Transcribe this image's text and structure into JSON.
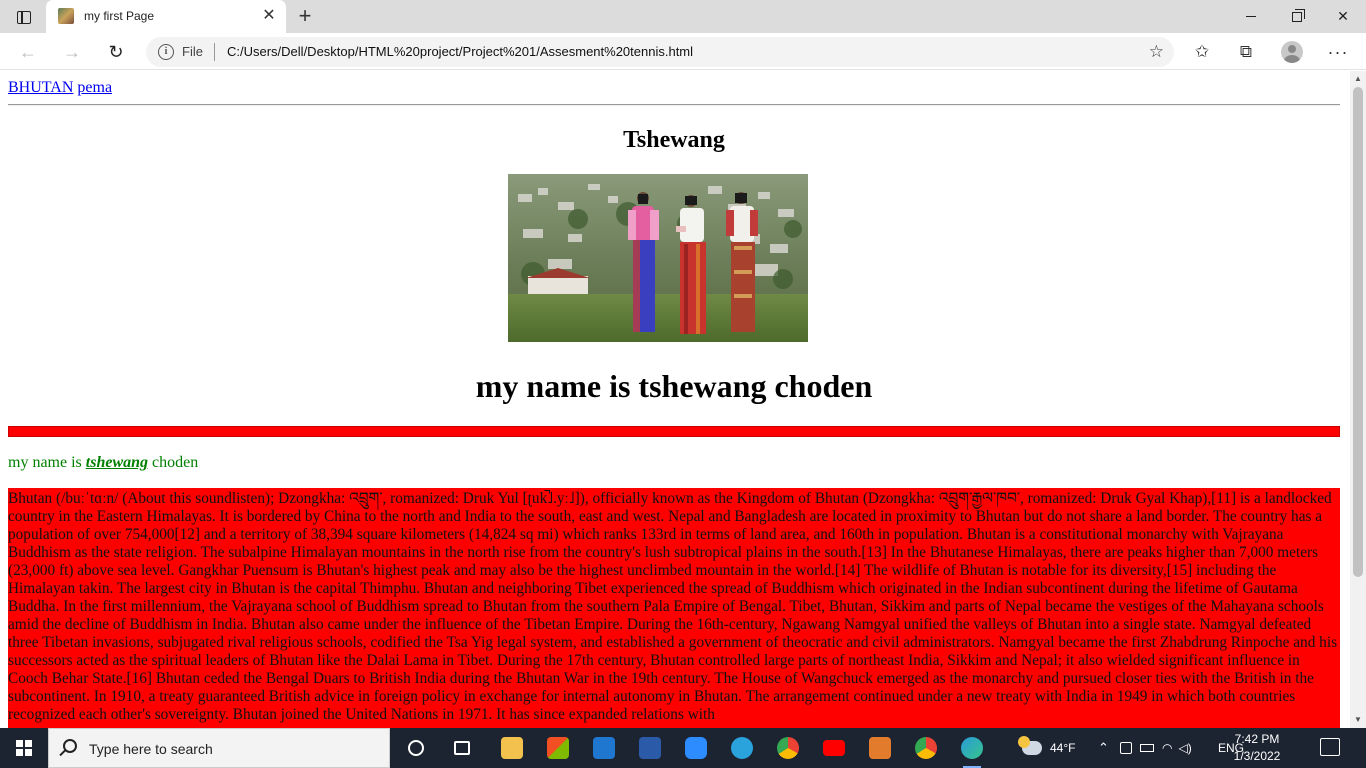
{
  "browser": {
    "tab_title": "my first Page",
    "tab_close": "✕",
    "new_tab": "+",
    "file_label": "File",
    "url": "C:/Users/Dell/Desktop/HTML%20project/Project%201/Assesment%20tennis.html",
    "nav_back": "←",
    "nav_forward": "→",
    "nav_reload": "↻",
    "favorites_add": "☆",
    "favorites": "✩",
    "collections": "⧉",
    "more": "···",
    "win_close": "✕"
  },
  "page": {
    "links": [
      "BHUTAN",
      "pema"
    ],
    "heading2": "Tshewang",
    "heading1": "my name is tshewang choden",
    "green_prefix": "my name is ",
    "green_emphasis": "tshewang",
    "green_suffix": " choden",
    "paragraph": "Bhutan (/buːˈtɑːn/ (About this soundlisten); Dzongkha: འབྲུག་, romanized: Druk Yul [ʈuk̚˩.yː˩]), officially known as the Kingdom of Bhutan (Dzongkha: འབྲུག་རྒྱལ་ཁབ་, romanized: Druk Gyal Khap),[11] is a landlocked country in the Eastern Himalayas. It is bordered by China to the north and India to the south, east and west. Nepal and Bangladesh are located in proximity to Bhutan but do not share a land border. The country has a population of over 754,000[12] and a territory of 38,394 square kilometers (14,824 sq mi) which ranks 133rd in terms of land area, and 160th in population. Bhutan is a constitutional monarchy with Vajrayana Buddhism as the state religion. The subalpine Himalayan mountains in the north rise from the country's lush subtropical plains in the south.[13] In the Bhutanese Himalayas, there are peaks higher than 7,000 meters (23,000 ft) above sea level. Gangkhar Puensum is Bhutan's highest peak and may also be the highest unclimbed mountain in the world.[14] The wildlife of Bhutan is notable for its diversity,[15] including the Himalayan takin. The largest city in Bhutan is the capital Thimphu. Bhutan and neighboring Tibet experienced the spread of Buddhism which originated in the Indian subcontinent during the lifetime of Gautama Buddha. In the first millennium, the Vajrayana school of Buddhism spread to Bhutan from the southern Pala Empire of Bengal. Tibet, Bhutan, Sikkim and parts of Nepal became the vestiges of the Mahayana schools amid the decline of Buddhism in India. Bhutan also came under the influence of the Tibetan Empire. During the 16th-century, Ngawang Namgyal unified the valleys of Bhutan into a single state. Namgyal defeated three Tibetan invasions, subjugated rival religious schools, codified the Tsa Yig legal system, and established a government of theocratic and civil administrators. Namgyal became the first Zhabdrung Rinpoche and his successors acted as the spiritual leaders of Bhutan like the Dalai Lama in Tibet. During the 17th century, Bhutan controlled large parts of northeast India, Sikkim and Nepal; it also wielded significant influence in Cooch Behar State.[16] Bhutan ceded the Bengal Duars to British India during the Bhutan War in the 19th century. The House of Wangchuck emerged as the monarchy and pursued closer ties with the British in the subcontinent. In 1910, a treaty guaranteed British advice in foreign policy in exchange for internal autonomy in Bhutan. The arrangement continued under a new treaty with India in 1949 in which both countries recognized each other's sovereignty. Bhutan joined the United Nations in 1971. It has since expanded relations with"
  },
  "colors": {
    "banner_red": "#ff0000",
    "green_text": "#008000",
    "link_blue": "#0000ee",
    "taskbar": "#1c2431"
  },
  "taskbar": {
    "search_placeholder": "Type here to search",
    "weather": "44°F",
    "language": "ENG",
    "time": "7:42 PM",
    "date": "1/3/2022",
    "icons": [
      "task-view-icon",
      "widgets-icon",
      "file-explorer-icon",
      "store-icon",
      "mail-icon",
      "word-icon",
      "zoom-icon",
      "telegram-icon",
      "chrome-icon",
      "youtube-icon",
      "sublime-icon",
      "chrome-icon",
      "edge-icon"
    ]
  }
}
